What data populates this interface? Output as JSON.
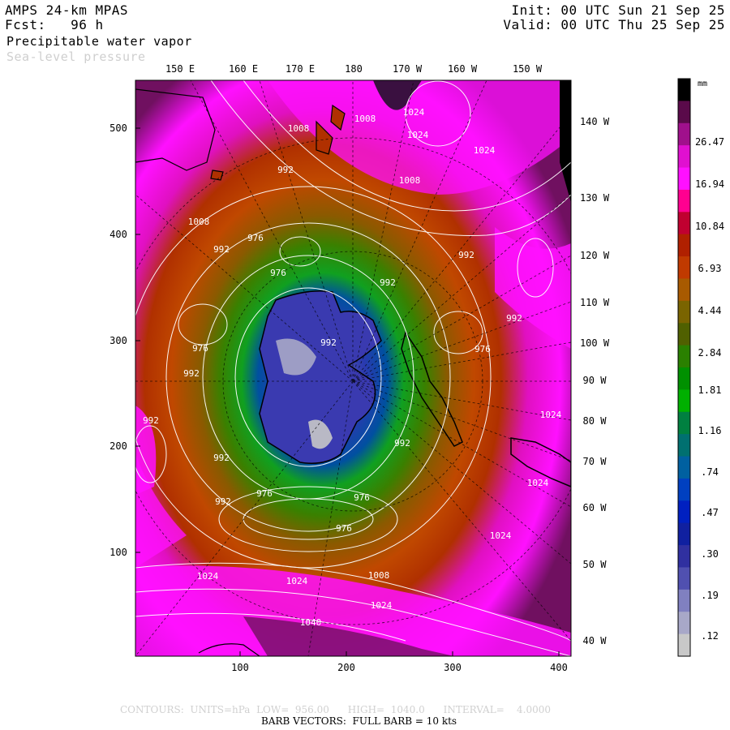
{
  "header": {
    "model": "AMPS 24-km MPAS",
    "forecast": "Fcst:   96 h",
    "field_primary": "Precipitable water vapor",
    "field_secondary": "Sea-level pressure",
    "init": "Init: 00 UTC Sun 21 Sep 25",
    "valid": "Valid: 00 UTC Thu 25 Sep 25"
  },
  "longitude_labels_top": [
    "150 E",
    "160 E",
    "170 E",
    "180",
    "170 W",
    "160 W",
    "150 W"
  ],
  "longitude_labels_right": [
    "140 W",
    "130 W",
    "120 W",
    "110 W",
    "100 W",
    "90 W",
    "80 W",
    "70 W",
    "60 W",
    "50 W",
    "40 W"
  ],
  "x_axis_ticks": [
    "100",
    "200",
    "300",
    "400"
  ],
  "y_axis_ticks": [
    "100",
    "200",
    "300",
    "400",
    "500"
  ],
  "colorbar": {
    "units": "mm",
    "labels": [
      "26.47",
      "16.94",
      "10.84",
      "6.93",
      "4.44",
      "2.84",
      "1.81",
      "1.16",
      ".74",
      ".47",
      ".30",
      ".19",
      ".12"
    ],
    "colors": [
      "#000000",
      "#5a0a4a",
      "#a0108c",
      "#e010d0",
      "#ff10ff",
      "#ff0090",
      "#c00030",
      "#b02000",
      "#c03a00",
      "#a85a00",
      "#7a6400",
      "#506000",
      "#2a8000",
      "#009000",
      "#00b000",
      "#008040",
      "#007070",
      "#0060a0",
      "#0040c0",
      "#0020c0",
      "#1020a0",
      "#3030a0",
      "#5050b0",
      "#8080c0",
      "#a8a8c8",
      "#c8c8c8"
    ]
  },
  "pressure_labels": [
    "1024",
    "1008",
    "1024",
    "1008",
    "1024",
    "992",
    "1008",
    "976",
    "992",
    "1008",
    "992",
    "976",
    "992",
    "992",
    "976",
    "976",
    "992",
    "992",
    "976",
    "992",
    "992",
    "976",
    "992",
    "976",
    "1024",
    "1024",
    "1008",
    "1024",
    "1024",
    "1024",
    "1040",
    "1024",
    "992"
  ],
  "footer": {
    "contours": "CONTOURS:  UNITS=hPa  LOW=  956.00      HIGH=  1040.0      INTERVAL=    4.0000",
    "barbs": "BARB VECTORS:  FULL BARB = 10 kts"
  },
  "theme": {
    "water_magenta": "#ff10ff",
    "water_orange": "#c04800",
    "water_green": "#10a020",
    "water_blue": "#2a3ab0",
    "contour_color": "#ffffff"
  }
}
